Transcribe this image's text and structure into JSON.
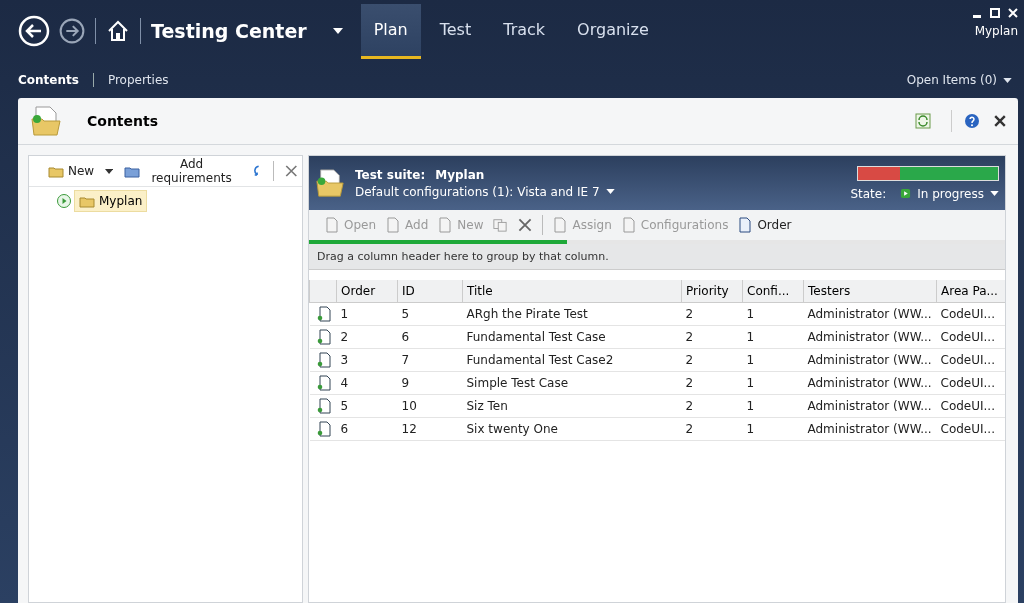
{
  "app": {
    "title": "Testing Center",
    "user": "Myplan"
  },
  "tabs": [
    {
      "label": "Plan",
      "selected": true
    },
    {
      "label": "Test",
      "selected": false
    },
    {
      "label": "Track",
      "selected": false
    },
    {
      "label": "Organize",
      "selected": false
    }
  ],
  "subnav": [
    {
      "label": "Contents",
      "selected": true
    },
    {
      "label": "Properties",
      "selected": false
    }
  ],
  "open_items": "Open Items (0)",
  "panel": {
    "title": "Contents"
  },
  "tree_toolbar": {
    "new": "New",
    "add": "Add requirements"
  },
  "tree": [
    {
      "label": "Myplan",
      "selected": true
    }
  ],
  "suite": {
    "label": "Test suite:",
    "name": "Myplan",
    "configs": "Default configurations (1):  Vista and IE 7",
    "state_label": "State:",
    "state": "In progress",
    "results": {
      "level": 0.7
    }
  },
  "toolbar": [
    {
      "kind": "text",
      "label": "Open",
      "disabled": true
    },
    {
      "kind": "text",
      "label": "Add",
      "disabled": true
    },
    {
      "kind": "text",
      "label": "New",
      "disabled": true
    },
    {
      "kind": "copy",
      "disabled": true
    },
    {
      "kind": "delete",
      "disabled": false
    },
    {
      "kind": "text",
      "label": "Assign",
      "disabled": true
    },
    {
      "kind": "text",
      "label": "Configurations",
      "disabled": true
    },
    {
      "kind": "text",
      "label": "Order",
      "disabled": false
    }
  ],
  "loading": {
    "level": 0.37
  },
  "group_hint": "Drag a column header here to group by that column.",
  "table": {
    "columns": [
      "Order",
      "ID",
      "Title",
      "Priority",
      "Confi...",
      "Testers",
      "Area Pa..."
    ],
    "rows": [
      [
        "1",
        "5",
        "ARgh the Pirate Test",
        "2",
        "1",
        "Administrator (WW...",
        "CodeUI..."
      ],
      [
        "2",
        "6",
        "Fundamental Test Case",
        "2",
        "1",
        "Administrator (WW...",
        "CodeUI..."
      ],
      [
        "3",
        "7",
        "Fundamental Test Case2",
        "2",
        "1",
        "Administrator (WW...",
        "CodeUI..."
      ],
      [
        "4",
        "9",
        "Simple Test Case",
        "2",
        "1",
        "Administrator (WW...",
        "CodeUI..."
      ],
      [
        "5",
        "10",
        "Siz Ten",
        "2",
        "1",
        "Administrator (WW...",
        "CodeUI..."
      ],
      [
        "6",
        "12",
        "Six twenty One",
        "2",
        "1",
        "Administrator (WW...",
        "CodeUI..."
      ]
    ]
  }
}
